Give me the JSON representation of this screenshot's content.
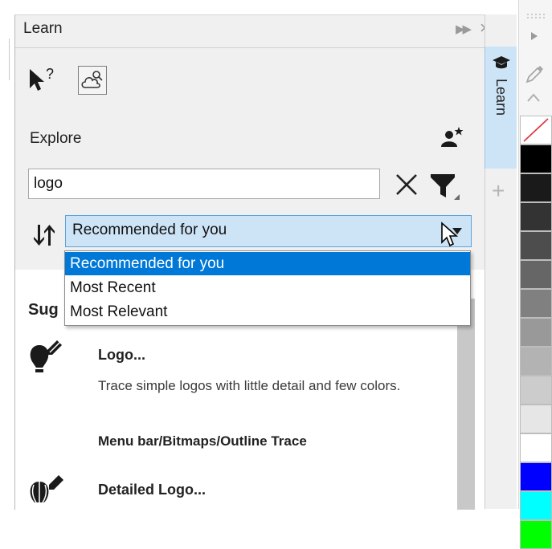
{
  "docker": {
    "title": "Learn",
    "collapse_icon": "double-chevron-right-icon",
    "close_icon": "close-icon"
  },
  "toolbar": {
    "help_pointer_icon": "whats-this-pointer-icon",
    "cloud_icon": "cloud-search-icon"
  },
  "explore": {
    "label": "Explore",
    "user_star_icon": "user-star-icon"
  },
  "search": {
    "value": "logo",
    "clear_icon": "close-icon",
    "filter_icon": "filter-icon"
  },
  "sort": {
    "icon": "sort-updown-icon",
    "selected": "Recommended for you",
    "options": [
      "Recommended for you",
      "Most Recent",
      "Most Relevant"
    ]
  },
  "content": {
    "heading": "Sug",
    "items": [
      {
        "title": "Logo...",
        "description": "Trace simple logos with little detail and few colors.",
        "path": "Menu bar/Bitmaps/Outline Trace"
      },
      {
        "title": "Detailed Logo..."
      }
    ]
  },
  "side_tab": {
    "label": "Learn",
    "icon": "graduation-cap-icon",
    "add_icon": "plus-icon"
  },
  "palette": {
    "swatches": [
      "none",
      "#000000",
      "#1a1a1a",
      "#333333",
      "#4d4d4d",
      "#666666",
      "#808080",
      "#999999",
      "#b3b3b3",
      "#cccccc",
      "#e6e6e6",
      "#ffffff",
      "#0000ff",
      "#00ffff",
      "#00ff00"
    ]
  },
  "colors": {
    "accent": "#0078d7",
    "select_bg": "#cde4f7",
    "panel_bg": "#f0f0f0"
  }
}
